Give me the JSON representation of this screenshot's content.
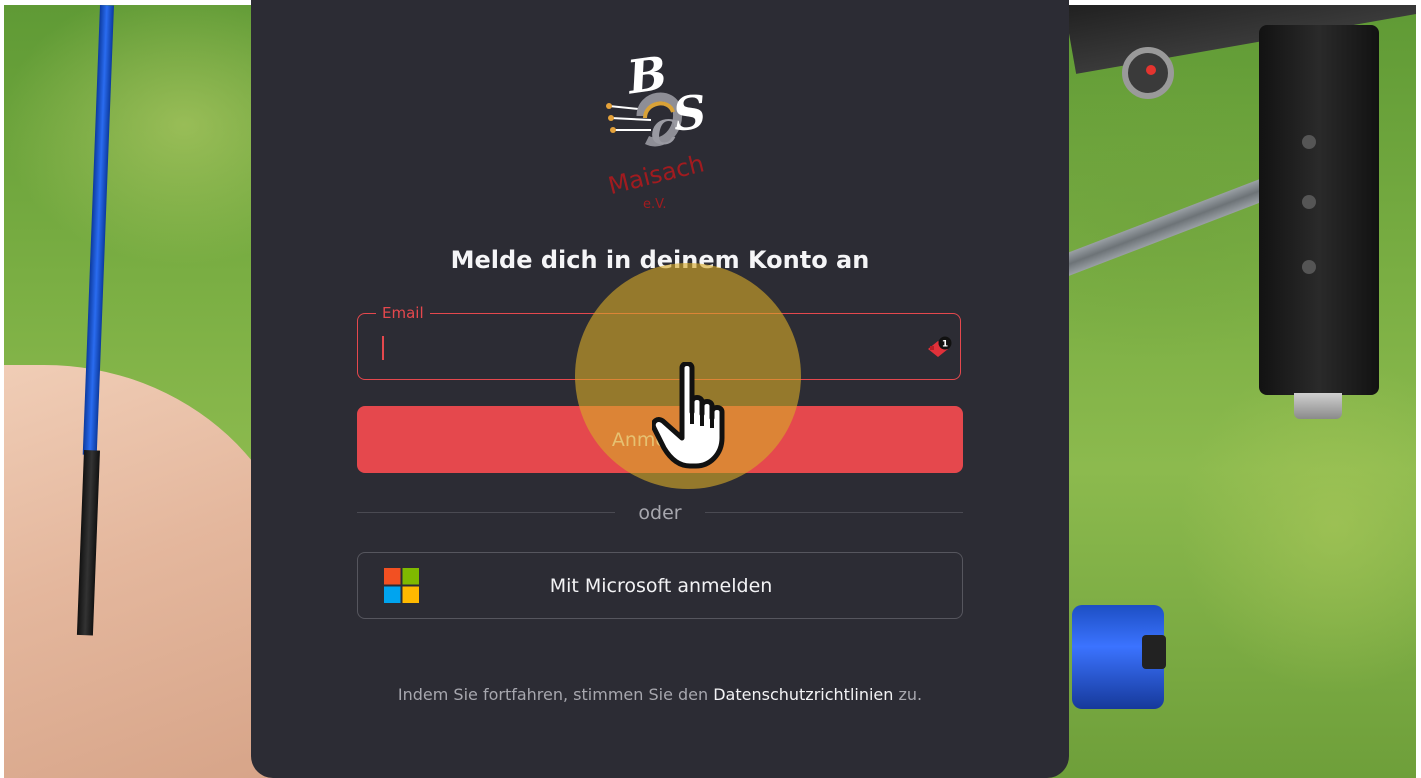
{
  "brand": {
    "logo_letters": "BSC",
    "logo_place": "Maisach",
    "logo_suffix": "e.V."
  },
  "login": {
    "heading": "Melde dich in deinem Konto an",
    "email_label": "Email",
    "email_value": "",
    "submit_label": "Anmelden",
    "divider_text": "oder",
    "microsoft_label": "Mit Microsoft anmelden",
    "footer_prefix": "Indem Sie fortfahren, stimmen Sie den",
    "footer_link": "Datenschutzrichtlinien",
    "footer_suffix": "zu."
  },
  "password_manager": {
    "icon": "password-manager-icon",
    "badge_count": "1"
  },
  "icons": {
    "microsoft": "microsoft-logo-icon",
    "cursor": "hand-pointer-icon"
  },
  "colors": {
    "accent": "#e5484d",
    "card_bg": "#2c2c34",
    "muted_text": "#a7a7ae"
  }
}
